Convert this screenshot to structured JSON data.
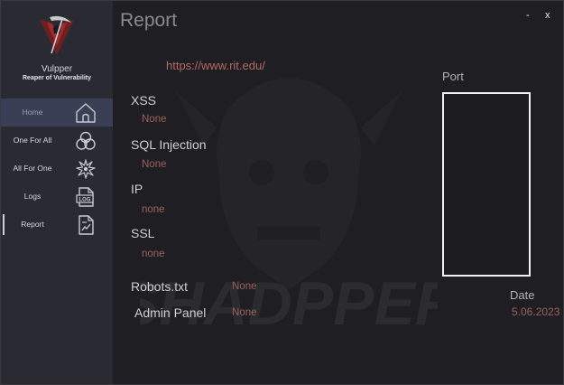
{
  "app": {
    "name": "Vulpper",
    "tagline": "Reaper of Vulnerability"
  },
  "sidebar": {
    "items": [
      {
        "label": "Home",
        "icon": "home-icon"
      },
      {
        "label": "One For All",
        "icon": "biohazard-icon"
      },
      {
        "label": "All For One",
        "icon": "splat-icon"
      },
      {
        "label": "Logs",
        "icon": "log-file-icon"
      },
      {
        "label": "Report",
        "icon": "chart-document-icon"
      }
    ]
  },
  "window": {
    "minimize_label": "-",
    "close_label": "x"
  },
  "report": {
    "title": "Report",
    "url": "https://www.rit.edu/",
    "xss_label": "XSS",
    "xss_value": "None",
    "sql_label": "SQL Injection",
    "sql_value": "None",
    "ip_label": "IP",
    "ip_value": "none",
    "ssl_label": "SSL",
    "ssl_value": "none",
    "robots_label": "Robots.txt",
    "robots_value": "None",
    "admin_label": "Admin Panel",
    "admin_value": "None",
    "port_label": "Port",
    "date_label": "Date",
    "date_value": "5.06.2023"
  },
  "watermark_text": "SHADPPER",
  "colors": {
    "sidebar_bg": "#2a2a33",
    "main_bg": "#1f1f23",
    "active_item_bg": "#3a3f55",
    "value_text": "#9a625c",
    "url_text": "#b46a62"
  }
}
